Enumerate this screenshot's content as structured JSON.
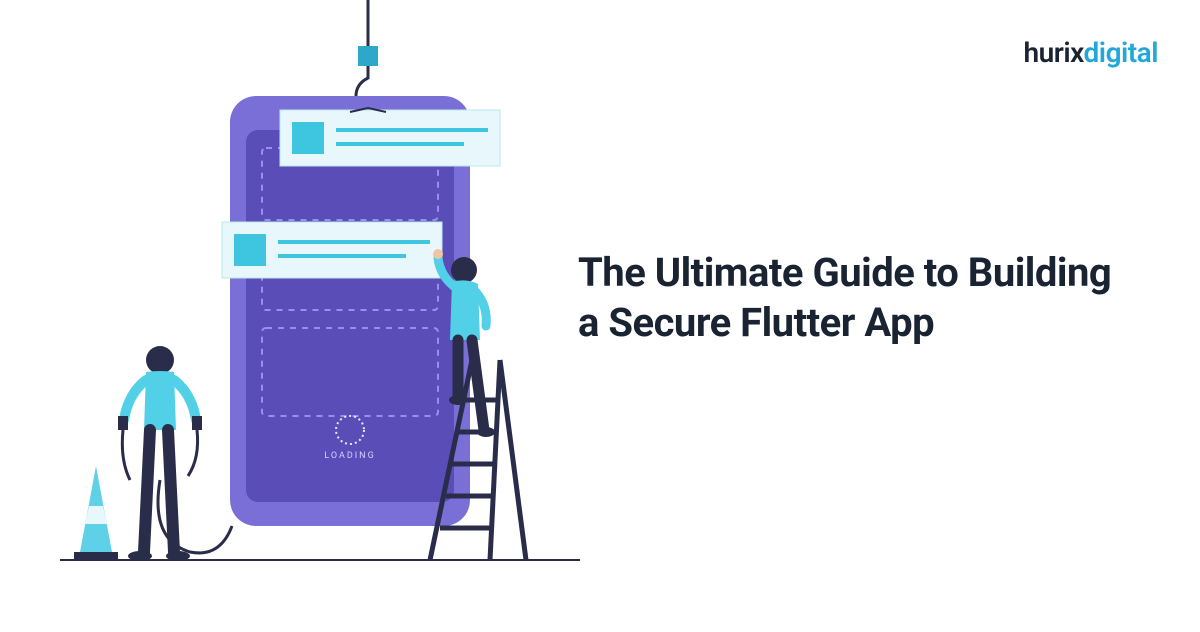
{
  "logo": {
    "part1": "hurix",
    "part2": "digital"
  },
  "headline": "The Ultimate Guide to Building a Secure Flutter App",
  "illustration": {
    "loading_label": "LOADING",
    "colors": {
      "phone_body": "#7a6fd6",
      "phone_screen": "#5b4db8",
      "accent_cyan": "#3ec5e0",
      "accent_light": "#b8e8f0",
      "person_skin": "#f2c5a0",
      "person_dark": "#2a2d4a",
      "hook_block": "#2ea8c9",
      "cone_fill": "#5ed0e8"
    }
  }
}
